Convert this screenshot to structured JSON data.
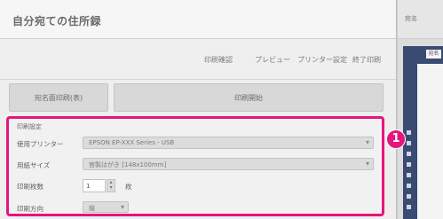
{
  "window": {
    "title": "自分宛ての住所録"
  },
  "toolbar": {
    "items": [
      "印刷確認",
      "プレビュー",
      "プリンター設定",
      "終了印刷"
    ]
  },
  "actions": {
    "side_button": "宛名面印刷(表)",
    "main_button": "印刷開始"
  },
  "settings": {
    "heading": "印刷設定",
    "printer": {
      "label": "使用プリンター",
      "value": "EPSON EP-XXX Series - USB"
    },
    "paper": {
      "label": "用紙サイズ",
      "value": "官製はがき [148x100mm]"
    },
    "copies": {
      "label": "印刷枚数",
      "value": "1",
      "unit": "枚"
    },
    "orientation": {
      "label": "印刷方向",
      "value": "縦"
    }
  },
  "callout": {
    "number": "1"
  },
  "side_panel": {
    "header": "宛名",
    "tag": "宛名"
  },
  "colors": {
    "accent": "#e4157d",
    "panel_navy": "#3a4a72"
  }
}
